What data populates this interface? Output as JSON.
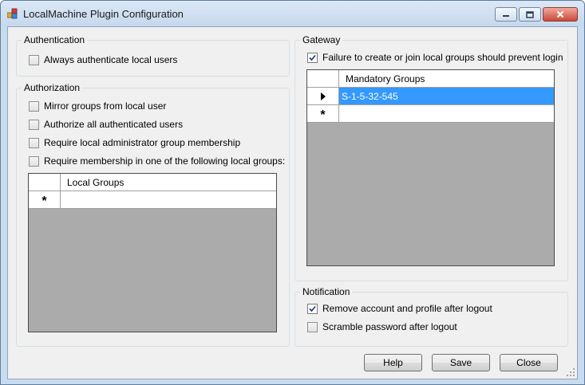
{
  "window": {
    "title": "LocalMachine Plugin Configuration"
  },
  "authentication": {
    "label": "Authentication",
    "always_authenticate": {
      "label": "Always authenticate local users",
      "checked": false
    }
  },
  "authorization": {
    "label": "Authorization",
    "mirror_groups": {
      "label": "Mirror groups from local user",
      "checked": false
    },
    "authorize_all": {
      "label": "Authorize all authenticated users",
      "checked": false
    },
    "require_admin": {
      "label": "Require local administrator group membership",
      "checked": false
    },
    "require_membership": {
      "label": "Require membership in one of the following local groups:",
      "checked": false
    },
    "grid": {
      "column_header": "Local Groups",
      "rows": [],
      "new_row_marker": "*"
    }
  },
  "gateway": {
    "label": "Gateway",
    "failure_prevent_login": {
      "label": "Failure to create or join local groups should prevent login",
      "checked": true
    },
    "grid": {
      "column_header": "Mandatory Groups",
      "rows": [
        "S-1-5-32-545"
      ],
      "selected_row": 0,
      "new_row_marker": "*"
    }
  },
  "notification": {
    "label": "Notification",
    "remove_account": {
      "label": "Remove account and profile after logout",
      "checked": true
    },
    "scramble_password": {
      "label": "Scramble password after logout",
      "checked": false
    }
  },
  "buttons": {
    "help": "Help",
    "save": "Save",
    "close": "Close"
  },
  "colors": {
    "selection": "#3399ff",
    "grid_background": "#ababab",
    "close_button": "#cc4a38"
  }
}
